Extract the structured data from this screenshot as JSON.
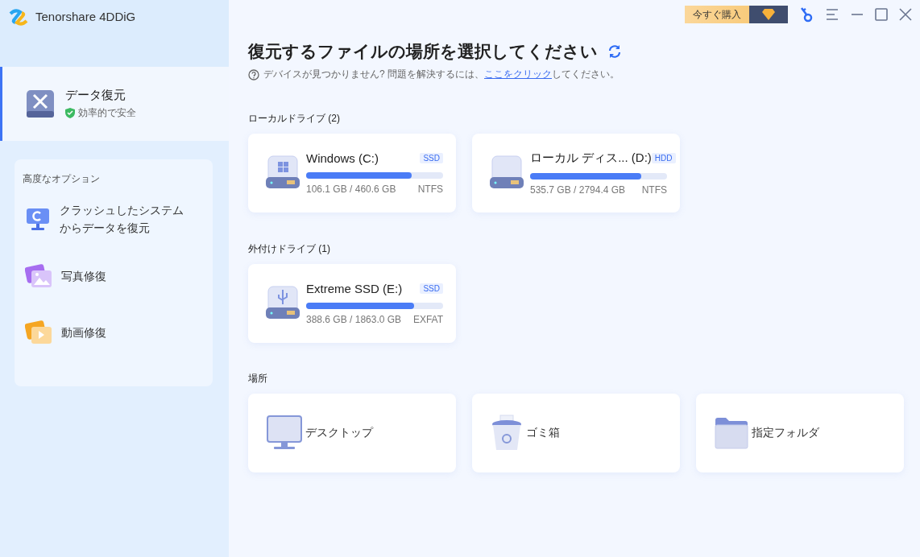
{
  "app": {
    "name": "Tenorshare 4DDiG"
  },
  "toolbar": {
    "buy_button": "今すぐ購入"
  },
  "sidebar": {
    "main_item": {
      "title": "データ復元",
      "subtitle": "効率的で安全",
      "selected": true
    },
    "advanced": {
      "heading": "高度なオプション",
      "items": [
        {
          "label": "クラッシュしたシステムからデータを復元",
          "kind": "crash"
        },
        {
          "label": "写真修復",
          "kind": "photo"
        },
        {
          "label": "動画修復",
          "kind": "video"
        }
      ]
    }
  },
  "header": {
    "title": "復元するファイルの場所を選択してください",
    "help_before": "デバイスが見つかりません? 問題を解決するには、",
    "help_link": "ここをクリック",
    "help_after": "してください。"
  },
  "sections": [
    {
      "heading": "ローカルドライブ (2)",
      "kind": "drives",
      "items": [
        {
          "name": "Windows (C:)",
          "type": "SSD",
          "level": 0.77,
          "usage": "106.1 GB / 460.6 GB",
          "fs": "NTFS",
          "kind": "windows"
        },
        {
          "name": "ローカル ディス... (D:)",
          "type": "HDD",
          "level": 0.81,
          "usage": "535.7 GB / 2794.4 GB",
          "fs": "NTFS",
          "kind": "plain"
        }
      ]
    },
    {
      "heading": "外付けドライブ (1)",
      "kind": "drives",
      "items": [
        {
          "name": "Extreme SSD (E:)",
          "type": "SSD",
          "level": 0.79,
          "usage": "388.6 GB / 1863.0 GB",
          "fs": "EXFAT",
          "kind": "usb"
        }
      ]
    },
    {
      "heading": "場所",
      "kind": "locations",
      "items": [
        {
          "label": "デスクトップ",
          "kind": "desktop"
        },
        {
          "label": "ゴミ箱",
          "kind": "trash"
        },
        {
          "label": "指定フォルダ",
          "kind": "folder"
        }
      ]
    }
  ]
}
